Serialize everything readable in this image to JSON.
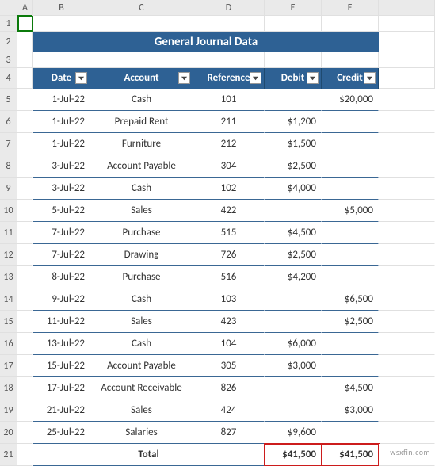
{
  "columns": [
    "",
    "A",
    "B",
    "C",
    "D",
    "E",
    "F",
    ""
  ],
  "title": "General Journal Data",
  "headers": {
    "date": "Date",
    "account": "Account",
    "ref": "Reference",
    "debit": "Debit",
    "credit": "Credit"
  },
  "chart_data": {
    "type": "table",
    "title": "General Journal Data",
    "columns": [
      "Date",
      "Account",
      "Reference",
      "Debit",
      "Credit"
    ],
    "rows": [
      {
        "date": "1-Jul-22",
        "account": "Cash",
        "ref": "101",
        "debit": "",
        "credit": "$20,000"
      },
      {
        "date": "1-Jul-22",
        "account": "Prepaid Rent",
        "ref": "211",
        "debit": "$1,200",
        "credit": ""
      },
      {
        "date": "1-Jul-22",
        "account": "Furniture",
        "ref": "212",
        "debit": "$1,500",
        "credit": ""
      },
      {
        "date": "3-Jul-22",
        "account": "Account Payable",
        "ref": "304",
        "debit": "$2,500",
        "credit": ""
      },
      {
        "date": "3-Jul-22",
        "account": "Cash",
        "ref": "102",
        "debit": "$4,000",
        "credit": ""
      },
      {
        "date": "5-Jul-22",
        "account": "Sales",
        "ref": "422",
        "debit": "",
        "credit": "$5,000"
      },
      {
        "date": "7-Jul-22",
        "account": "Purchase",
        "ref": "515",
        "debit": "$4,500",
        "credit": ""
      },
      {
        "date": "7-Jul-22",
        "account": "Drawing",
        "ref": "726",
        "debit": "$2,500",
        "credit": ""
      },
      {
        "date": "8-Jul-22",
        "account": "Purchase",
        "ref": "516",
        "debit": "$4,200",
        "credit": ""
      },
      {
        "date": "9-Jul-22",
        "account": "Cash",
        "ref": "103",
        "debit": "",
        "credit": "$6,500"
      },
      {
        "date": "11-Jul-22",
        "account": "Sales",
        "ref": "423",
        "debit": "",
        "credit": "$2,500"
      },
      {
        "date": "13-Jul-22",
        "account": "Cash",
        "ref": "104",
        "debit": "$6,000",
        "credit": ""
      },
      {
        "date": "15-Jul-22",
        "account": "Account Payable",
        "ref": "305",
        "debit": "$3,000",
        "credit": ""
      },
      {
        "date": "17-Jul-22",
        "account": "Account Receivable",
        "ref": "826",
        "debit": "",
        "credit": "$4,500"
      },
      {
        "date": "21-Jul-22",
        "account": "Sales",
        "ref": "424",
        "debit": "",
        "credit": "$3,000"
      },
      {
        "date": "25-Jul-22",
        "account": "Salaries",
        "ref": "827",
        "debit": "$9,600",
        "credit": ""
      }
    ],
    "total": {
      "label": "Total",
      "debit": "$41,500",
      "credit": "$41,500"
    }
  },
  "watermark": "wsxfin.com"
}
